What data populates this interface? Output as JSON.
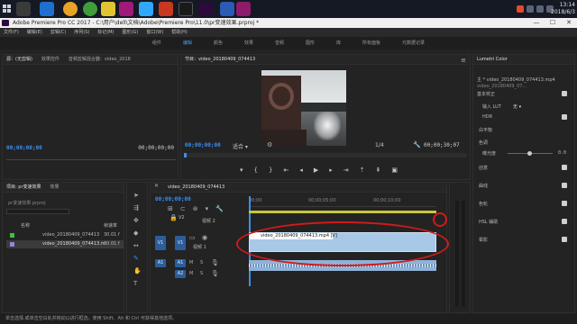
{
  "taskbar": {
    "time": "13:14",
    "date": "2018/6/3"
  },
  "window": {
    "title": "Adobe Premiere Pro CC 2017 - C:\\用户\\dell\\文档\\Adobe\\Premiere Pro\\11.0\\pr变速效果.prproj *",
    "min": "—",
    "max": "☐",
    "close": "✕"
  },
  "menu": [
    "文件(F)",
    "编辑(E)",
    "剪辑(C)",
    "序列(S)",
    "标记(M)",
    "图形(G)",
    "窗口(W)",
    "帮助(H)"
  ],
  "workspaces": [
    "组件",
    "编辑",
    "颜色",
    "效果",
    "音频",
    "图形",
    "库",
    "所有面板",
    "元数据记录"
  ],
  "workspace_active": "编辑",
  "source_panel": {
    "tabs": [
      "源：(无剪辑)",
      "效果控件",
      "音频剪辑混合器：video_2018"
    ],
    "timecode": "00;00;00;00",
    "right_timecode": "00;00;00;00"
  },
  "program_panel": {
    "title": "节目：video_20180409_074413",
    "timecode": "00;00;00;00",
    "fit": "适合",
    "quality": "1/4",
    "duration": "00;00;30;07"
  },
  "project_panel": {
    "tabs": [
      "项目: pr变速效果",
      "效果"
    ],
    "file": "pr变速效果.prproj",
    "col_name": "名称",
    "col_fps": "帧速率",
    "items": [
      {
        "name": "video_20180409_074413",
        "fps": "30.01 f"
      },
      {
        "name": "video_20180409_074413.m",
        "fps": "30.01 f"
      }
    ]
  },
  "timeline": {
    "title": "video_20180409_074413",
    "timecode": "00;00;00;00",
    "ruler": [
      "00;00",
      "00;00;05;00",
      "00;00;10;00"
    ],
    "tracks": [
      {
        "name": "V2",
        "label": "视频 2"
      },
      {
        "name": "V1",
        "label": "视频 1"
      },
      {
        "name": "A1",
        "label": ""
      },
      {
        "name": "A2",
        "label": ""
      }
    ],
    "clip_label": "video_20180409_074413.mp4 [V]",
    "letters": [
      "V1",
      "A1"
    ]
  },
  "lumetri": {
    "title": "Lumetri Color",
    "source": "主 * video_20180409_074413.mp4",
    "seq": "video_20180409_07...",
    "basic": "基本校正",
    "input_lut": "输入 LUT",
    "lut_val": "无",
    "hdr": "HDR",
    "white_balance": "白平衡",
    "tone": "色调",
    "exposure": "曝光度",
    "exposure_val": "0.0",
    "sections": [
      "创意",
      "曲线",
      "色轮",
      "HSL 辅助",
      "晕影"
    ]
  },
  "status": "单击选择,或单击空白处并拖动以进行框选。使用 Shift、Alt 和 Ctrl 可获得其他选项。"
}
